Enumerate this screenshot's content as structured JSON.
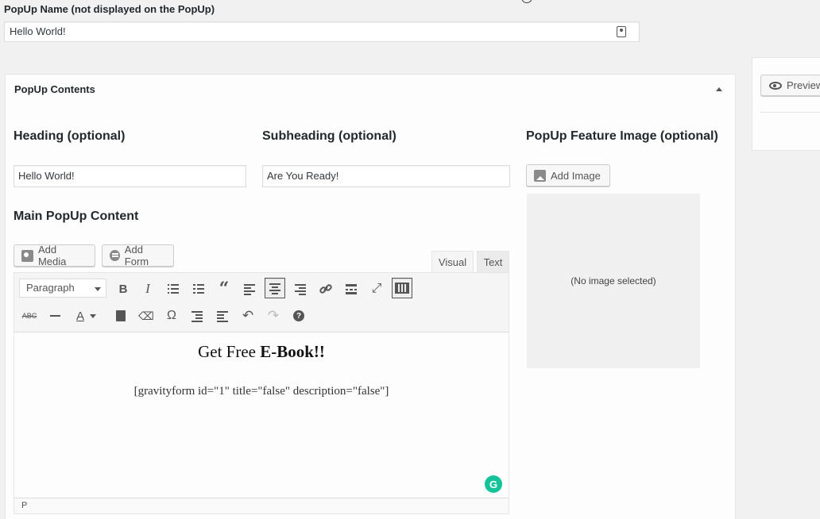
{
  "popup_name": {
    "label": "PopUp Name (not displayed on the PopUp)",
    "value": "Hello World!"
  },
  "contents_panel": {
    "title": "PopUp Contents"
  },
  "heading": {
    "label": "Heading (optional)",
    "value": "Hello World!"
  },
  "subheading": {
    "label": "Subheading (optional)",
    "value": "Are You Ready!"
  },
  "feature_image": {
    "label": "PopUp Feature Image (optional)",
    "add_button": "Add Image",
    "empty_text": "(No image selected)"
  },
  "main_content": {
    "label": "Main PopUp Content",
    "add_media": "Add Media",
    "add_form": "Add Form",
    "tabs": {
      "visual": "Visual",
      "text": "Text"
    },
    "format_select": "Paragraph",
    "heading_prefix": "Get Free ",
    "heading_bold": "E-Book!!",
    "shortcode": "[gravityform id=\"1\" title=\"false\" description=\"false\"]",
    "status_path": "P",
    "grammarly": "G"
  },
  "sidebar": {
    "preview_button": "Preview"
  }
}
